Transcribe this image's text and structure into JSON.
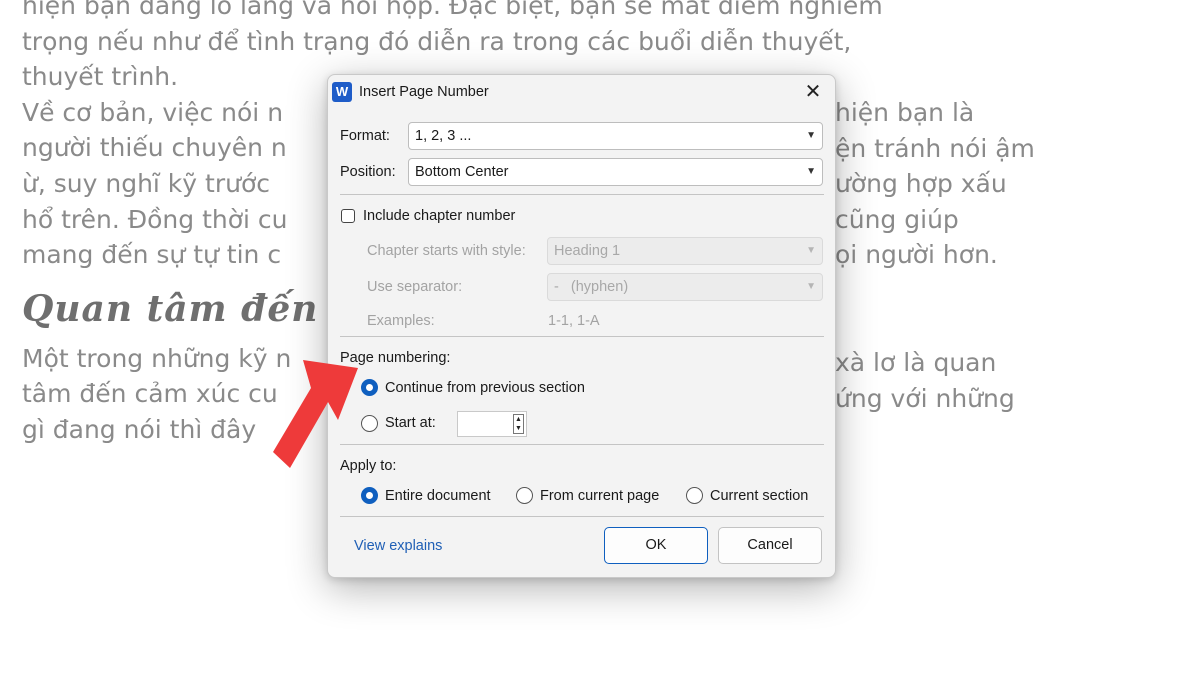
{
  "document": {
    "lines_para1": [
      "hiện bạn đang lo lắng và hồi hộp. Đặc biệt, bạn sẽ mất điểm nghiêm",
      "trọng nếu như để tình trạng đó diễn ra trong các buổi diễn thuyết,",
      "thuyết trình.",
      "Về cơ bản, việc nói n",
      "người thiếu chuyên n",
      "ừ, suy nghĩ kỹ trước",
      "hổ trên. Đồng thời cu",
      "mang đến sự tự tin c"
    ],
    "lines_para1_right": [
      "hiện bạn là",
      "ện tránh nói ậm",
      "ường hợp xấu",
      "cũng giúp",
      "ọi người hơn."
    ],
    "heading": "Quan tâm đến",
    "lines_para2": [
      "Một trong những kỹ n",
      "tâm đến cảm xúc cu",
      "gì đang nói thì đây"
    ],
    "lines_para2_right": [
      "xà lơ là quan",
      "ứng với những"
    ]
  },
  "dialog": {
    "app_icon_letter": "W",
    "title": "Insert Page Number",
    "close_glyph": "✕",
    "format_label": "Format:",
    "format_value": "1, 2, 3 ...",
    "position_label": "Position:",
    "position_value": "Bottom Center",
    "include_chapter_label": "Include chapter number",
    "include_chapter_checked": false,
    "chapter_style_label": "Chapter starts with style:",
    "chapter_style_value": "Heading 1",
    "separator_label": "Use separator:",
    "separator_value": "-   (hyphen)",
    "examples_label": "Examples:",
    "examples_value": "1-1, 1-A",
    "page_numbering_label": "Page numbering:",
    "continue_label": "Continue from previous section",
    "start_at_label": "Start at:",
    "start_at_value": "",
    "apply_to_label": "Apply to:",
    "apply_entire": "Entire document",
    "apply_from_current": "From current page",
    "apply_current_section": "Current section",
    "view_explains": "View explains",
    "ok_label": "OK",
    "cancel_label": "Cancel",
    "dropdown_glyph": "▼",
    "spin_up": "▲",
    "spin_down": "▼"
  },
  "colors": {
    "accent": "#0f5fbf",
    "arrow": "#ee3a3a",
    "dialog_bg": "#f3f3f3",
    "doc_text": "#8a8a8a"
  }
}
